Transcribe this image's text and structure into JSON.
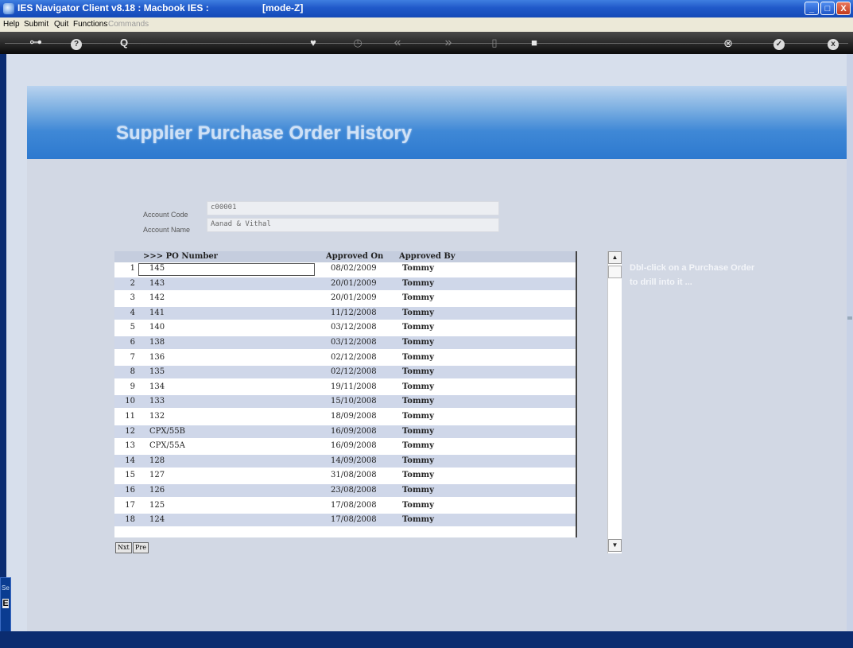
{
  "window": {
    "title": "IES Navigator Client v8.18 : Macbook IES :",
    "mode": "[mode-Z]",
    "buttons": {
      "minimize": "_",
      "maximize": "□",
      "close": "X"
    }
  },
  "menu": [
    "Help",
    "Submit",
    "Quit",
    "Functions",
    "Commands"
  ],
  "toolbar": {
    "icons": [
      "key-icon",
      "help-icon",
      "search-icon",
      "heart-icon",
      "clock-icon",
      "rewind-icon",
      "forward-icon",
      "document-icon",
      "stop-icon",
      "cancel-icon",
      "check-icon",
      "close-icon"
    ],
    "glyphs": {
      "key": "⊶",
      "help": "?",
      "search": "Q",
      "heart": "♥",
      "clock": "◷",
      "rewind": "«",
      "forward": "»",
      "doc": "▯",
      "stop": "■",
      "cancel": "⊗",
      "check": "✓",
      "close": "x"
    }
  },
  "page": {
    "title": "Supplier Purchase Order History"
  },
  "account": {
    "code_label": "Account Code",
    "code_value": "c00001",
    "name_label": "Account Name",
    "name_value": "Aanad & Vithal"
  },
  "grid": {
    "columns": {
      "po": ">>> PO Number",
      "approved_on": "Approved On",
      "approved_by": "Approved By"
    },
    "rows": [
      {
        "n": "1",
        "po": "145",
        "date": "08/02/2009",
        "by": "Tommy"
      },
      {
        "n": "2",
        "po": "143",
        "date": "20/01/2009",
        "by": "Tommy"
      },
      {
        "n": "3",
        "po": "142",
        "date": "20/01/2009",
        "by": "Tommy"
      },
      {
        "n": "4",
        "po": "141",
        "date": "11/12/2008",
        "by": "Tommy"
      },
      {
        "n": "5",
        "po": "140",
        "date": "03/12/2008",
        "by": "Tommy"
      },
      {
        "n": "6",
        "po": "138",
        "date": "03/12/2008",
        "by": "Tommy"
      },
      {
        "n": "7",
        "po": "136",
        "date": "02/12/2008",
        "by": "Tommy"
      },
      {
        "n": "8",
        "po": "135",
        "date": "02/12/2008",
        "by": "Tommy"
      },
      {
        "n": "9",
        "po": "134",
        "date": "19/11/2008",
        "by": "Tommy"
      },
      {
        "n": "10",
        "po": "133",
        "date": "15/10/2008",
        "by": "Tommy"
      },
      {
        "n": "11",
        "po": "132",
        "date": "18/09/2008",
        "by": "Tommy"
      },
      {
        "n": "12",
        "po": "CPX/55B",
        "date": "16/09/2008",
        "by": "Tommy"
      },
      {
        "n": "13",
        "po": "CPX/55A",
        "date": "16/09/2008",
        "by": "Tommy"
      },
      {
        "n": "14",
        "po": "128",
        "date": "14/09/2008",
        "by": "Tommy"
      },
      {
        "n": "15",
        "po": "127",
        "date": "31/08/2008",
        "by": "Tommy"
      },
      {
        "n": "16",
        "po": "126",
        "date": "23/08/2008",
        "by": "Tommy"
      },
      {
        "n": "17",
        "po": "125",
        "date": "17/08/2008",
        "by": "Tommy"
      },
      {
        "n": "18",
        "po": "124",
        "date": "17/08/2008",
        "by": "Tommy"
      }
    ],
    "pager": {
      "next": "Nxt",
      "prev": "Pre"
    }
  },
  "scroll": {
    "up": "▲",
    "down": "▼"
  },
  "hint": {
    "line1": "Dbl-click on a Purchase Order",
    "line2": "to drill into it ..."
  },
  "side_tab": {
    "label": "Se",
    "badge": "E"
  }
}
